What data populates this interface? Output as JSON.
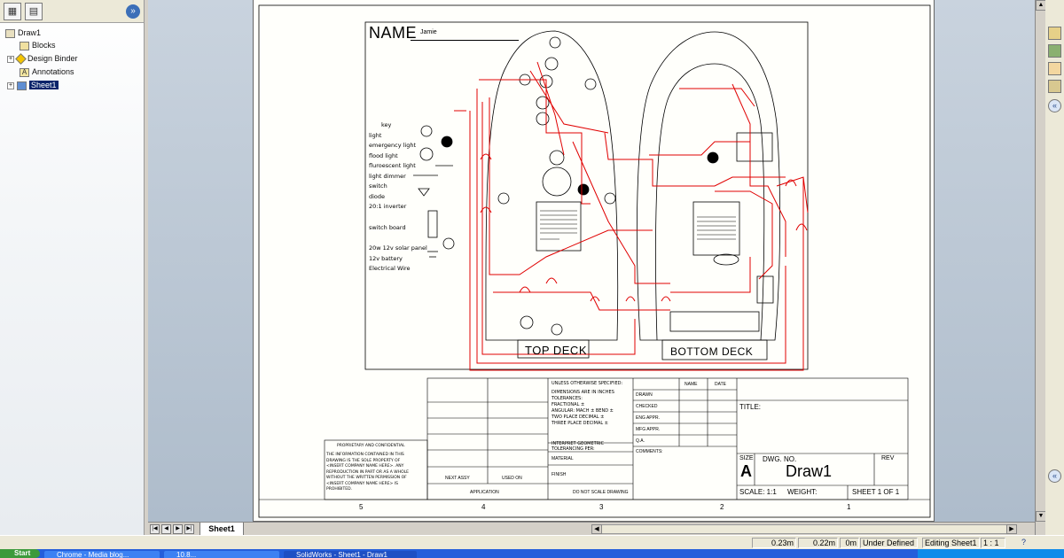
{
  "feature_tree": {
    "root": "Draw1",
    "items": [
      {
        "label": "Blocks",
        "icon": "blocks-folder-icon"
      },
      {
        "label": "Design Binder",
        "icon": "design-binder-icon"
      },
      {
        "label": "Annotations",
        "icon": "annotations-icon"
      },
      {
        "label": "Sheet1",
        "icon": "sheet-icon",
        "selected": true
      }
    ]
  },
  "sheet_tab": "Sheet1",
  "drawing": {
    "name_label": "NAME",
    "name_value": "Jamie",
    "top_deck_label": "TOP DECK",
    "bottom_deck_label": "BOTTOM DECK",
    "key": {
      "title": "key",
      "items": [
        "light",
        "emergency light",
        "flood light",
        "fluroescent light",
        "light dimmer",
        "switch",
        "diode",
        "20:1 inverter",
        "switch board",
        "20w 12v solar panel",
        "12v battery",
        "Electrical Wire"
      ]
    }
  },
  "title_block": {
    "unless": "UNLESS OTHERWISE SPECIFIED:",
    "dimensions": [
      "DIMENSIONS ARE IN INCHES",
      "TOLERANCES:",
      "FRACTIONAL ±",
      "ANGULAR: MACH ±    BEND ±",
      "TWO PLACE DECIMAL    ±",
      "THREE PLACE DECIMAL   ±"
    ],
    "interpret": [
      "INTERPRET GEOMETRIC",
      "TOLERANCING PER:"
    ],
    "material": "MATERIAL",
    "finish": "FINISH",
    "do_not_scale": "DO NOT SCALE DRAWING",
    "next_assy": "NEXT ASSY",
    "used_on": "USED ON",
    "application": "APPLICATION",
    "name_col": "NAME",
    "date_col": "DATE",
    "rows": [
      "DRAWN",
      "CHECKED",
      "ENG APPR.",
      "MFG APPR.",
      "Q.A.",
      "COMMENTS:"
    ],
    "title": "TITLE:",
    "size_label": "SIZE",
    "size_value": "A",
    "dwg_no_label": "DWG.  NO.",
    "dwg_no_value": "Draw1",
    "rev_label": "REV",
    "scale": "SCALE: 1:1",
    "weight": "WEIGHT:",
    "sheet_of": "SHEET 1 OF 1",
    "proprietary_title": "PROPRIETARY AND CONFIDENTIAL",
    "proprietary_text": [
      "THE INFORMATION CONTAINED IN THIS",
      "DRAWING IS THE SOLE PROPERTY OF",
      "<INSERT COMPANY NAME HERE>. ANY",
      "REPRODUCTION IN PART OR AS A WHOLE",
      "WITHOUT THE WRITTEN PERMISSION OF",
      "<INSERT COMPANY NAME HERE> IS",
      "PROHIBITED."
    ],
    "zones": [
      "5",
      "4",
      "3",
      "2",
      "1"
    ]
  },
  "status_bar": {
    "x": "0.23m",
    "y": "0.22m",
    "z": "0m",
    "state": "Under Defined",
    "editing": "Editing Sheet1",
    "scale": "1 : 1"
  },
  "taskbar": {
    "start": "Start",
    "tasks": [
      "Chrome - Media blog...",
      "10.8...",
      "SolidWorks - Sheet1 - Draw1"
    ]
  },
  "colors": {
    "wire": "#e00000",
    "outline": "#000000",
    "selection": "#0a246a"
  }
}
